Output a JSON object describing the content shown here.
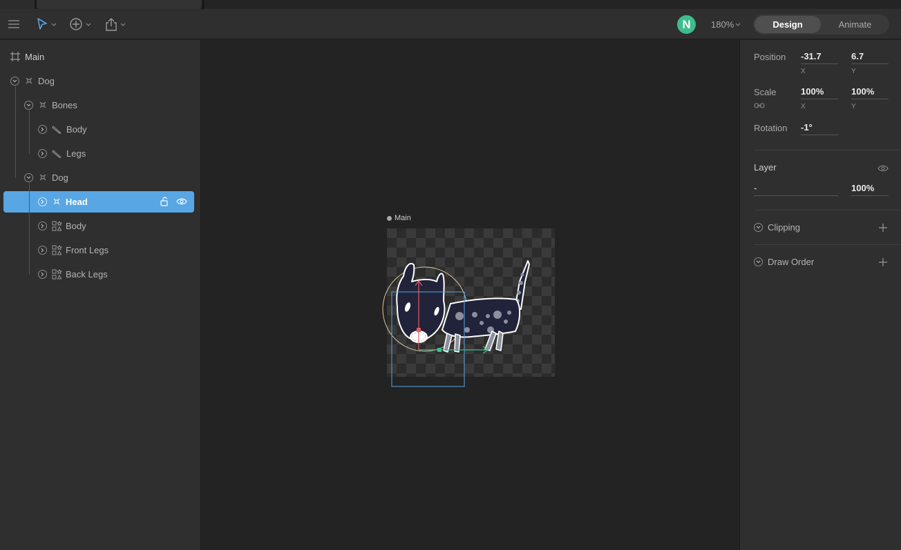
{
  "toolbar": {
    "menu_icon": "hamburger-icon",
    "select_tool_icon": "cursor-arrow-icon",
    "add_tool_icon": "plus-circle-icon",
    "share_icon": "export-icon",
    "avatar_initial": "N",
    "zoom_label": "180%",
    "design_label": "Design",
    "animate_label": "Animate",
    "avatar_color": "#3ebc8e"
  },
  "hierarchy": {
    "root_label": "Main",
    "items": [
      {
        "label": "Dog",
        "icon": "group-node-icon"
      },
      {
        "label": "Bones",
        "icon": "group-node-icon"
      },
      {
        "label": "Body",
        "icon": "bone-icon"
      },
      {
        "label": "Legs",
        "icon": "bone-icon"
      },
      {
        "label": "Dog",
        "icon": "group-node-icon"
      },
      {
        "label": "Head",
        "icon": "group-node-icon",
        "selected": true
      },
      {
        "label": "Body",
        "icon": "shapes-icon"
      },
      {
        "label": "Front Legs",
        "icon": "shapes-icon"
      },
      {
        "label": "Back Legs",
        "icon": "shapes-icon"
      }
    ],
    "selected_color": "#58a6e4"
  },
  "canvas": {
    "artboard_label": "Main"
  },
  "properties": {
    "position_label": "Position",
    "position_x": "-31.7",
    "position_y": "6.7",
    "scale_label": "Scale",
    "scale_x": "100%",
    "scale_y": "100%",
    "rotation_label": "Rotation",
    "rotation": "-1°",
    "x_axis": "X",
    "y_axis": "Y",
    "layer_label": "Layer",
    "layer_blend": "-",
    "layer_opacity": "100%",
    "clipping_label": "Clipping",
    "draw_order_label": "Draw Order"
  }
}
